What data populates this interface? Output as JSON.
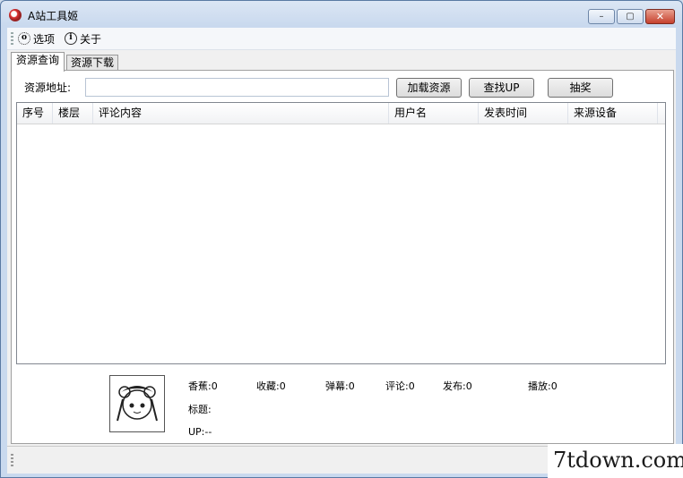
{
  "window": {
    "title": "A站工具姬"
  },
  "titlebar_buttons": {
    "minimize": "–",
    "maximize": "▢",
    "close": "✕"
  },
  "menu": {
    "options": "选项",
    "about": "关于"
  },
  "tabs": [
    "资源查询",
    "资源下载"
  ],
  "query": {
    "url_label": "资源地址:",
    "url_value": "",
    "load_button": "加载资源",
    "find_up_button": "查找UP",
    "lottery_button": "抽奖"
  },
  "table": {
    "columns": [
      "序号",
      "楼层",
      "评论内容",
      "用户名",
      "发表时间",
      "来源设备"
    ],
    "rows": []
  },
  "stats": {
    "banana": "香蕉:0",
    "favorites": "收藏:0",
    "danmaku": "弹幕:0",
    "comments": "评论:0",
    "published": "发布:0",
    "plays": "播放:0",
    "title_label": "标题:",
    "up_label": "UP:--"
  },
  "watermark": "7tdown.com"
}
